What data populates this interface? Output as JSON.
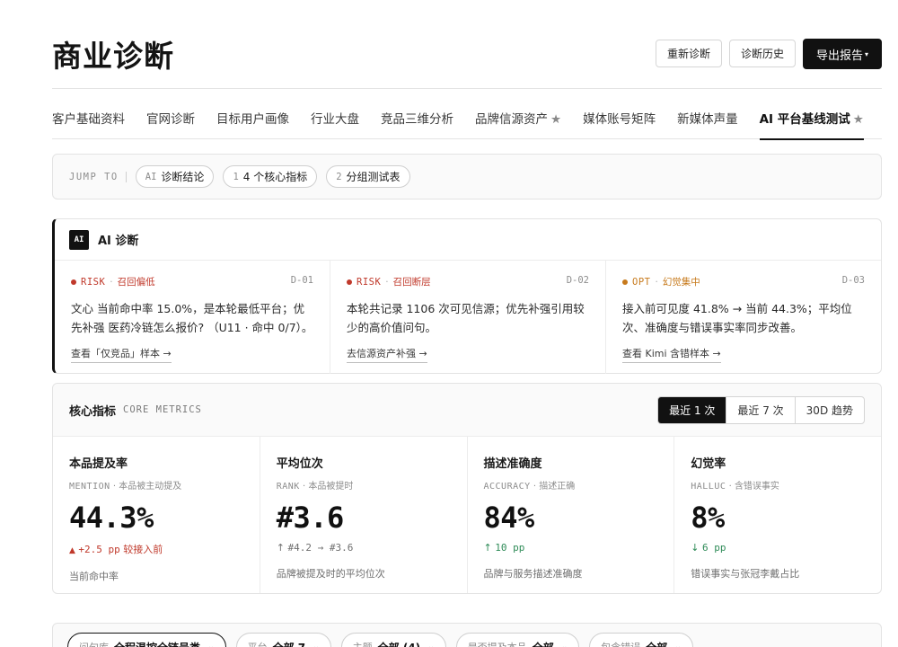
{
  "header": {
    "title": "商业诊断",
    "actions": {
      "rediagnose": "重新诊断",
      "history": "诊断历史",
      "export": "导出报告"
    },
    "export_caret": "▾"
  },
  "tabs": [
    {
      "label": "客户基础资料"
    },
    {
      "label": "官网诊断"
    },
    {
      "label": "目标用户画像"
    },
    {
      "label": "行业大盘"
    },
    {
      "label": "竞品三维分析"
    },
    {
      "label": "品牌信源资产",
      "star": "★"
    },
    {
      "label": "媒体账号矩阵"
    },
    {
      "label": "新媒体声量"
    },
    {
      "label": "AI 平台基线测试",
      "star": "★",
      "active": true
    }
  ],
  "jump": {
    "label": "JUMP TO",
    "items": [
      {
        "idx": "AI",
        "label": "诊断结论"
      },
      {
        "idx": "1",
        "label": "4 个核心指标"
      },
      {
        "idx": "2",
        "label": "分组测试表"
      }
    ]
  },
  "ai_diagnosis": {
    "badge": "AI",
    "title": "AI 诊断",
    "findings": [
      {
        "kind": "RISK",
        "sep": "·",
        "tag": "召回偏低",
        "id": "D-01",
        "color": "#c0392b",
        "text": "文心 当前命中率 15.0%，是本轮最低平台；优先补强 医药冷链怎么报价? （U11 · 命中 0/7）。",
        "link": "查看「仅竞品」样本 →"
      },
      {
        "kind": "RISK",
        "sep": "·",
        "tag": "召回断层",
        "id": "D-02",
        "color": "#c0392b",
        "text": "本轮共记录 1106 次可见信源；优先补强引用较少的高价值问句。",
        "link": "去信源资产补强 →"
      },
      {
        "kind": "OPT",
        "sep": "·",
        "tag": "幻觉集中",
        "id": "D-03",
        "color": "#c77a1c",
        "text": "接入前可见度 41.8% → 当前 44.3%；平均位次、准确度与错误事实率同步改善。",
        "link": "查看 Kimi 含错样本 →"
      }
    ]
  },
  "metrics": {
    "title": "核心指标",
    "subtitle": "CORE METRICS",
    "ranges": [
      {
        "label": "最近 1 次",
        "active": true
      },
      {
        "label": "最近 7 次"
      },
      {
        "label": "30D 趋势"
      }
    ],
    "items": [
      {
        "name": "本品提及率",
        "code": "MENTION",
        "sep": "·",
        "hint": "本品被主动提及",
        "value": "44.3%",
        "delta_arrow": "▲",
        "delta_value": "+2.5 pp",
        "delta_note": "较接入前",
        "delta_color": "#c0392b",
        "desc": "当前命中率"
      },
      {
        "name": "平均位次",
        "code": "RANK",
        "sep": "·",
        "hint": "本品被提时",
        "value": "#3.6",
        "delta_arrow": "↑",
        "delta_value": "#4.2 → #3.6",
        "delta_note": "",
        "delta_color": "#6e6e6e",
        "desc": "品牌被提及时的平均位次"
      },
      {
        "name": "描述准确度",
        "code": "ACCURACY",
        "sep": "·",
        "hint": "描述正确",
        "value": "84%",
        "delta_arrow": "↑",
        "delta_value": "10 pp",
        "delta_note": "",
        "delta_color": "#2e8b57",
        "desc": "品牌与服务描述准确度"
      },
      {
        "name": "幻觉率",
        "code": "HALLUC",
        "sep": "·",
        "hint": "含错误事实",
        "value": "8%",
        "delta_arrow": "↓",
        "delta_value": "6 pp",
        "delta_note": "",
        "delta_color": "#2e8b57",
        "desc": "错误事实与张冠李戴占比"
      }
    ]
  },
  "filters": [
    {
      "label": "问句库",
      "value": "全程温控全链号类",
      "caret": "⌄",
      "active": true
    },
    {
      "label": "平台",
      "value": "全部 7",
      "caret": "⌄"
    },
    {
      "label": "主题",
      "value": "全部 (4)",
      "caret": "⌄"
    },
    {
      "label": "是否提及本品",
      "value": "全部",
      "caret": "⌄"
    },
    {
      "label": "包含错误",
      "value": "全部",
      "caret": "⌄"
    }
  ]
}
